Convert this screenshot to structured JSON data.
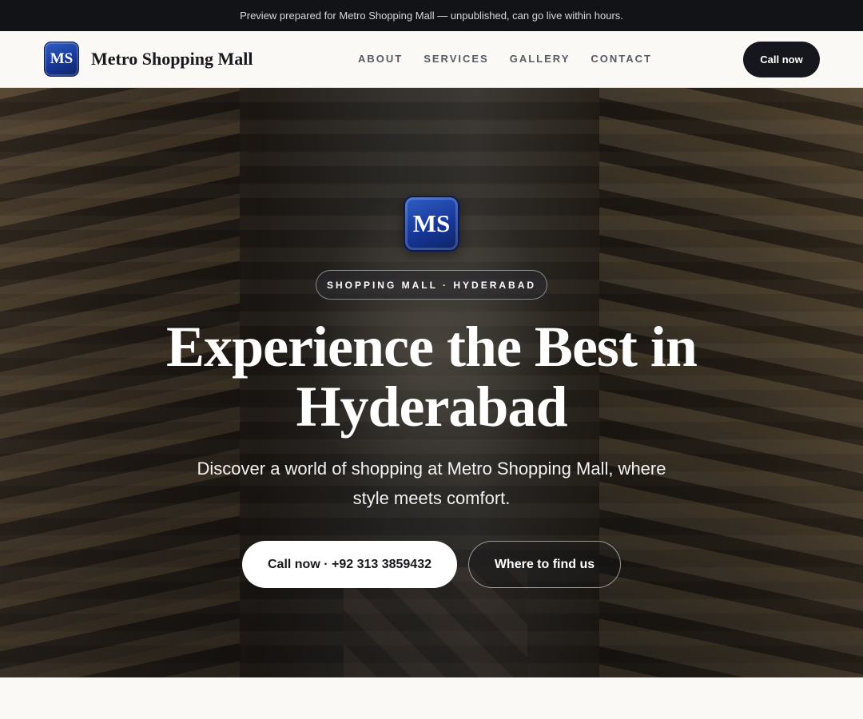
{
  "banner": {
    "text": "Preview prepared for Metro Shopping Mall — unpublished, can go live within hours."
  },
  "brand": {
    "initials": "MS",
    "name": "Metro Shopping Mall",
    "badge_color": "#17389a"
  },
  "nav": {
    "links": [
      "ABOUT",
      "SERVICES",
      "GALLERY",
      "CONTACT"
    ],
    "cta_label": "Call now"
  },
  "hero": {
    "badge_initials": "MS",
    "kicker": "SHOPPING MALL · HYDERABAD",
    "headline": "Experience the Best in Hyderabad",
    "subline": "Discover a world of shopping at Metro Shopping Mall, where style meets comfort.",
    "primary_cta": "Call now · +92 313 3859432",
    "secondary_cta": "Where to find us"
  }
}
